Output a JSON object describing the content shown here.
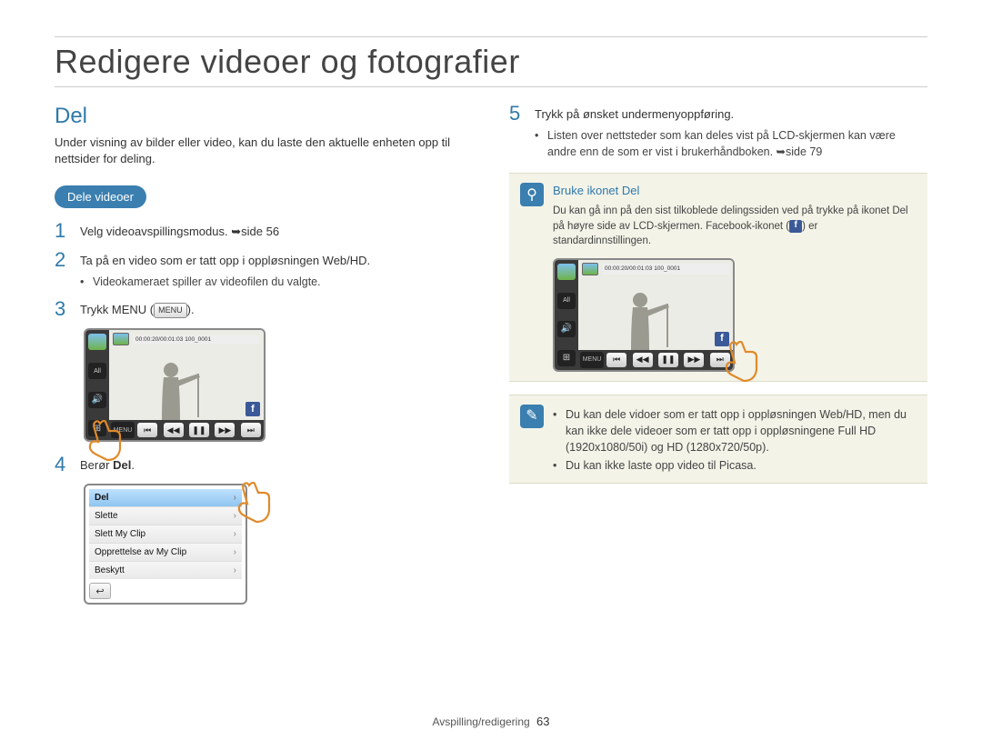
{
  "page": {
    "title": "Redigere videoer og fotografier",
    "footer_section": "Avspilling/redigering",
    "footer_page": "63"
  },
  "left": {
    "h2": "Del",
    "intro": "Under visning av bilder eller video, kan du laste den aktuelle enheten opp til nettsider for deling.",
    "pill": "Dele videoer",
    "steps": {
      "s1": {
        "num": "1",
        "text_a": "Velg videoavspillingsmodus. ",
        "text_b": "side 56"
      },
      "s2": {
        "num": "2",
        "text": "Ta på en video som er tatt opp i oppløsningen Web/HD.",
        "bullet": "Videokameraet spiller av videofilen du valgte."
      },
      "s3": {
        "num": "3",
        "text_a": "Trykk MENU (",
        "btn": "MENU",
        "text_b": ")."
      },
      "s4": {
        "num": "4",
        "text_a": "Berør ",
        "bold": "Del",
        "text_b": "."
      }
    },
    "lcd": {
      "timebar": "00:00:20/00:01:03  100_0001",
      "side_labels": {
        "all": "All",
        "vol": "🔊",
        "grid": "⊞"
      },
      "menu": "MENU",
      "controls": [
        "⏮",
        "◀◀",
        "❚❚",
        "▶▶",
        "⏭"
      ]
    },
    "menu_items": [
      "Del",
      "Slette",
      "Slett My Clip",
      "Opprettelse av My Clip",
      "Beskytt"
    ],
    "menu_back": "↩"
  },
  "right": {
    "step5": {
      "num": "5",
      "text": "Trykk på ønsket undermenyoppføring.",
      "bullet_a": "Listen over nettsteder som kan deles vist på LCD-skjermen kan være andre enn de som er vist i brukerhåndboken. ",
      "bullet_b": "side 79"
    },
    "info1": {
      "title": "Bruke ikonet Del",
      "body_a": "Du kan gå inn på den sist tilkoblede delingssiden ved på trykke på ikonet Del på høyre side av LCD-skjermen. Facebook-ikonet (",
      "body_b": ") er standardinnstillingen."
    },
    "info2": {
      "bullet1": "Du kan dele vidoer som er tatt opp i oppløsningen Web/HD, men du kan ikke dele videoer som er tatt opp i oppløsningene Full HD (1920x1080/50i) og HD (1280x720/50p).",
      "bullet2": "Du kan ikke laste opp video til Picasa."
    }
  },
  "icons": {
    "fb": "f",
    "magnify": "⚲",
    "note": "✎",
    "arrow": "➥"
  }
}
